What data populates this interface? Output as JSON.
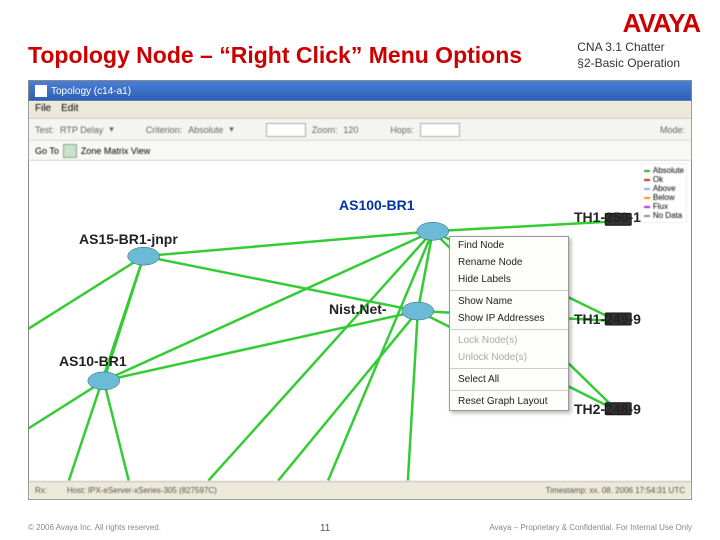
{
  "logo": "AVAYA",
  "title": "Topology Node – “Right Click” Menu Options",
  "chatter": {
    "line1": "CNA 3.1 Chatter",
    "line2": "§2-Basic Operation"
  },
  "window": {
    "titlebar": "Topology (c14-a1)",
    "menus": [
      "File",
      "Edit"
    ],
    "toolbar1": {
      "test_lbl": "Test:",
      "test_val": "RTP Delay",
      "crit_lbl": "Criterion:",
      "crit_val": "Absolute",
      "zoom_lbl": "Zoom:",
      "zoom_val": "120",
      "hops_lbl": "Hops:",
      "mode_lbl": "Mode:"
    },
    "toolbar2": {
      "view": "Zone Matrix View"
    },
    "legend": [
      {
        "color": "#2a2",
        "label": "Absolute"
      },
      {
        "color": "#c22",
        "label": "Ok"
      },
      {
        "color": "#8af",
        "label": "Above"
      },
      {
        "color": "#f80",
        "label": "Below"
      },
      {
        "color": "#a2f",
        "label": "Flux"
      },
      {
        "color": "#888",
        "label": "No Data"
      }
    ],
    "nodes": {
      "as100br1": "AS100-BR1",
      "as15br1jnpr": "AS15-BR1-jnpr",
      "nistnet": "Nist.Net-",
      "as10br1": "AS10-BR1",
      "th1_250_1": "TH1-250-1",
      "th1_249_9": "TH1-249-9",
      "th2_248_9": "TH2-248-9"
    },
    "context_menu": [
      {
        "t": "Find Node",
        "d": false
      },
      {
        "t": "Rename Node",
        "d": false
      },
      {
        "t": "Hide Labels",
        "d": false
      },
      {
        "sep": true
      },
      {
        "t": "Show Name",
        "d": false
      },
      {
        "t": "Show IP Addresses",
        "d": false
      },
      {
        "sep": true
      },
      {
        "t": "Lock Node(s)",
        "d": true
      },
      {
        "t": "Unlock Node(s)",
        "d": true
      },
      {
        "sep": true
      },
      {
        "t": "Select All",
        "d": false
      },
      {
        "sep": true
      },
      {
        "t": "Reset Graph Layout",
        "d": false
      }
    ],
    "statusbar": {
      "left": "Rx:",
      "mid": "Host: IPX-eServer-xSeries-305 (827597C)",
      "right": "Timestamp: xx. 08. 2006 17:54:31 UTC"
    }
  },
  "footer": {
    "copyright": "© 2006 Avaya Inc. All rights reserved.",
    "page": "11",
    "conf": "Avaya – Proprietary & Confidential. For Internal Use Only"
  }
}
